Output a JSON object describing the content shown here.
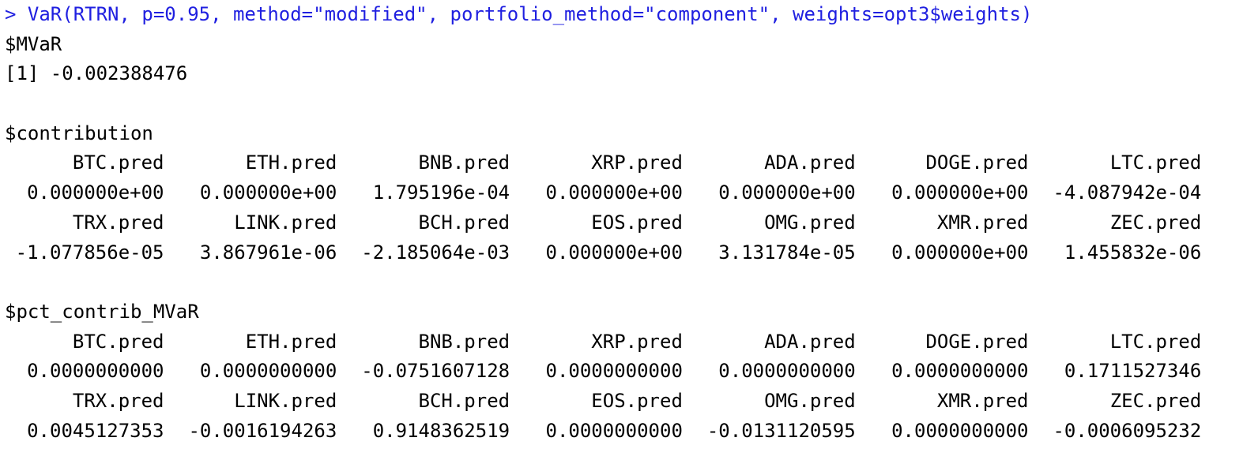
{
  "console": {
    "command": "> VaR(RTRN, p=0.95, method=\"modified\", portfolio_method=\"component\", weights=opt3$weights)",
    "mvar_label": "$MVaR",
    "mvar_value": "[1] -0.002388476",
    "contribution_label": "$contribution",
    "contribution": {
      "row1_headers": [
        "BTC.pred",
        "ETH.pred",
        "BNB.pred",
        "XRP.pred",
        "ADA.pred",
        "DOGE.pred",
        "LTC.pred"
      ],
      "row1_values": [
        "0.000000e+00",
        "0.000000e+00",
        "1.795196e-04",
        "0.000000e+00",
        "0.000000e+00",
        "0.000000e+00",
        "-4.087942e-04"
      ],
      "row2_headers": [
        "TRX.pred",
        "LINK.pred",
        "BCH.pred",
        "EOS.pred",
        "OMG.pred",
        "XMR.pred",
        "ZEC.pred"
      ],
      "row2_values": [
        "-1.077856e-05",
        "3.867961e-06",
        "-2.185064e-03",
        "0.000000e+00",
        "3.131784e-05",
        "0.000000e+00",
        "1.455832e-06"
      ]
    },
    "pct_label": "$pct_contrib_MVaR",
    "pct": {
      "row1_headers": [
        "BTC.pred",
        "ETH.pred",
        "BNB.pred",
        "XRP.pred",
        "ADA.pred",
        "DOGE.pred",
        "LTC.pred"
      ],
      "row1_values": [
        "0.0000000000",
        "0.0000000000",
        "-0.0751607128",
        "0.0000000000",
        "0.0000000000",
        "0.0000000000",
        "0.1711527346"
      ],
      "row2_headers": [
        "TRX.pred",
        "LINK.pred",
        "BCH.pred",
        "EOS.pred",
        "OMG.pred",
        "XMR.pred",
        "ZEC.pred"
      ],
      "row2_values": [
        "0.0045127353",
        "-0.0016194263",
        "0.9148362519",
        "0.0000000000",
        "-0.0131120595",
        "0.0000000000",
        "-0.0006095232"
      ]
    }
  }
}
